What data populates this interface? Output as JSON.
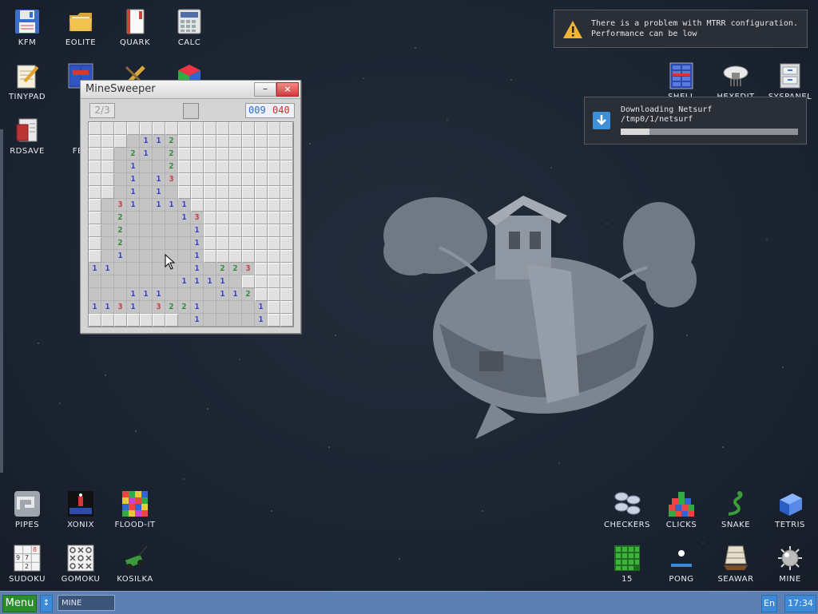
{
  "desktop_icons": {
    "kfm": "KFM",
    "eolite": "EOLITE",
    "quark": "QUARK",
    "calc": "CALC",
    "tinypad": "TINYPAD",
    "rdsave": "RDSAVE",
    "fb2": "FB2",
    "shell": "SHELL",
    "hexedit": "HEXEDIT",
    "syspanel": "SYSPANEL",
    "pipes": "PIPES",
    "xonix": "XONIX",
    "flood_it": "FLOOD-IT",
    "sudoku": "SUDOKU",
    "gomoku": "GOMOKU",
    "kosilka": "KOSILKA",
    "checkers": "CHECKERS",
    "clicks": "CLICKS",
    "snake": "SNAKE",
    "tetris": "TETRIS",
    "fifteen": "15",
    "pong": "PONG",
    "seawar": "SEAWAR",
    "mine": "MINE"
  },
  "minesweeper": {
    "title": "MineSweeper",
    "minimize": "–",
    "close": "×",
    "level": "2/3",
    "mines_left": "009",
    "timer": "040",
    "board": [
      "################",
      "###.112#########",
      "##.21.2#########",
      "##.1..2#########",
      "##.1.13#########",
      "##.1.1.#########",
      "#.31.111########",
      "#.2....13#######",
      "#.2.....1#######",
      "#.2.....1#######",
      "#.1.....1#######",
      "11......1.223###",
      ".......1111.####",
      "...111....112###",
      "1131.3221....1##",
      "#######.1....1##"
    ]
  },
  "notifications": {
    "warning_line1": "There is a problem with MTRR configuration.",
    "warning_line2": "Performance can be low",
    "download_title": "Downloading Netsurf",
    "download_path": "/tmp0/1/netsurf",
    "download_progress": 0.16
  },
  "taskbar": {
    "menu": "Menu",
    "arrows": "↕",
    "task": "MINE",
    "lang": "En",
    "clock": "17:34"
  }
}
